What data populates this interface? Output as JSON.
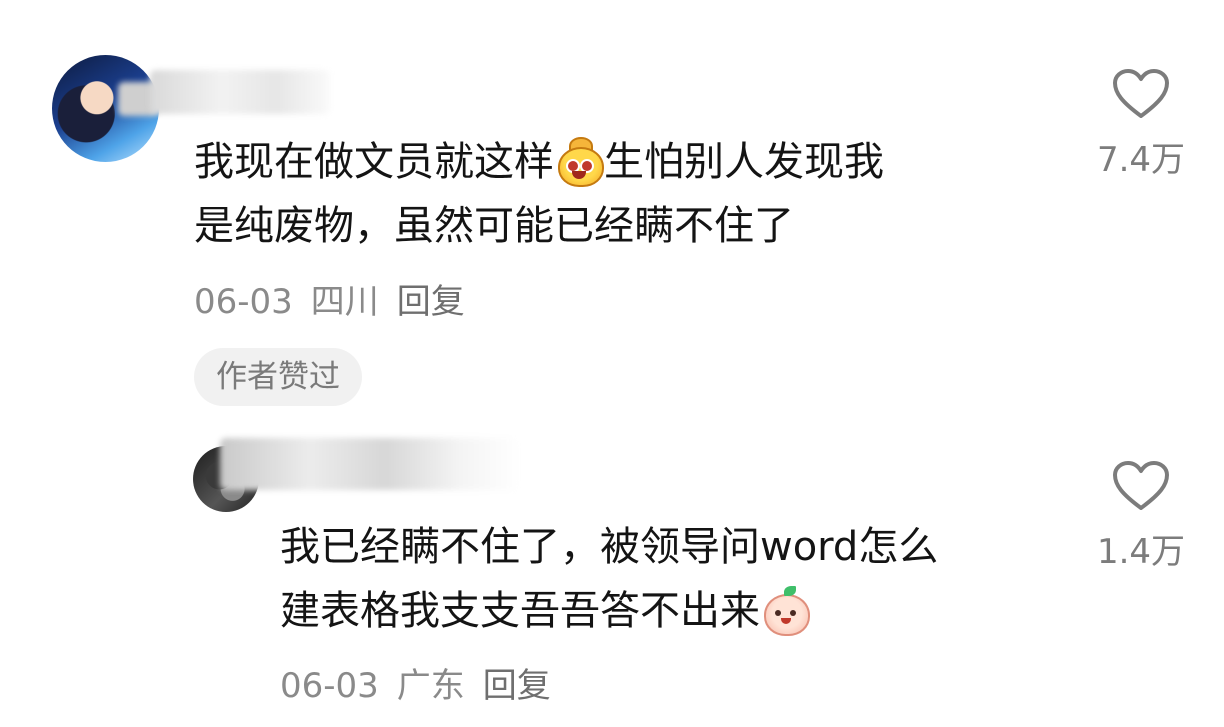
{
  "comments": [
    {
      "text_line1_a": "我现在做文员就这样",
      "emoji": "money-bag-face-emoji",
      "text_line1_b": "生怕别人发现我",
      "text_line2": "是纯废物，虽然可能已经瞒不住了",
      "date": "06-03",
      "location": "四川",
      "reply_label": "回复",
      "author_liked_label": "作者赞过",
      "like_count": "7.4万"
    },
    {
      "text_line1": "我已经瞒不住了，被领导问word怎么",
      "text_line2_a": "建表格我支支吾吾答不出来",
      "emoji": "peach-face-emoji",
      "date": "06-03",
      "location": "广东",
      "reply_label": "回复",
      "like_count": "1.4万"
    }
  ],
  "colors": {
    "text": "#141414",
    "meta": "#8a8a8a",
    "heart_outline": "#7c7c7c",
    "badge_bg": "#f1f1f1"
  }
}
